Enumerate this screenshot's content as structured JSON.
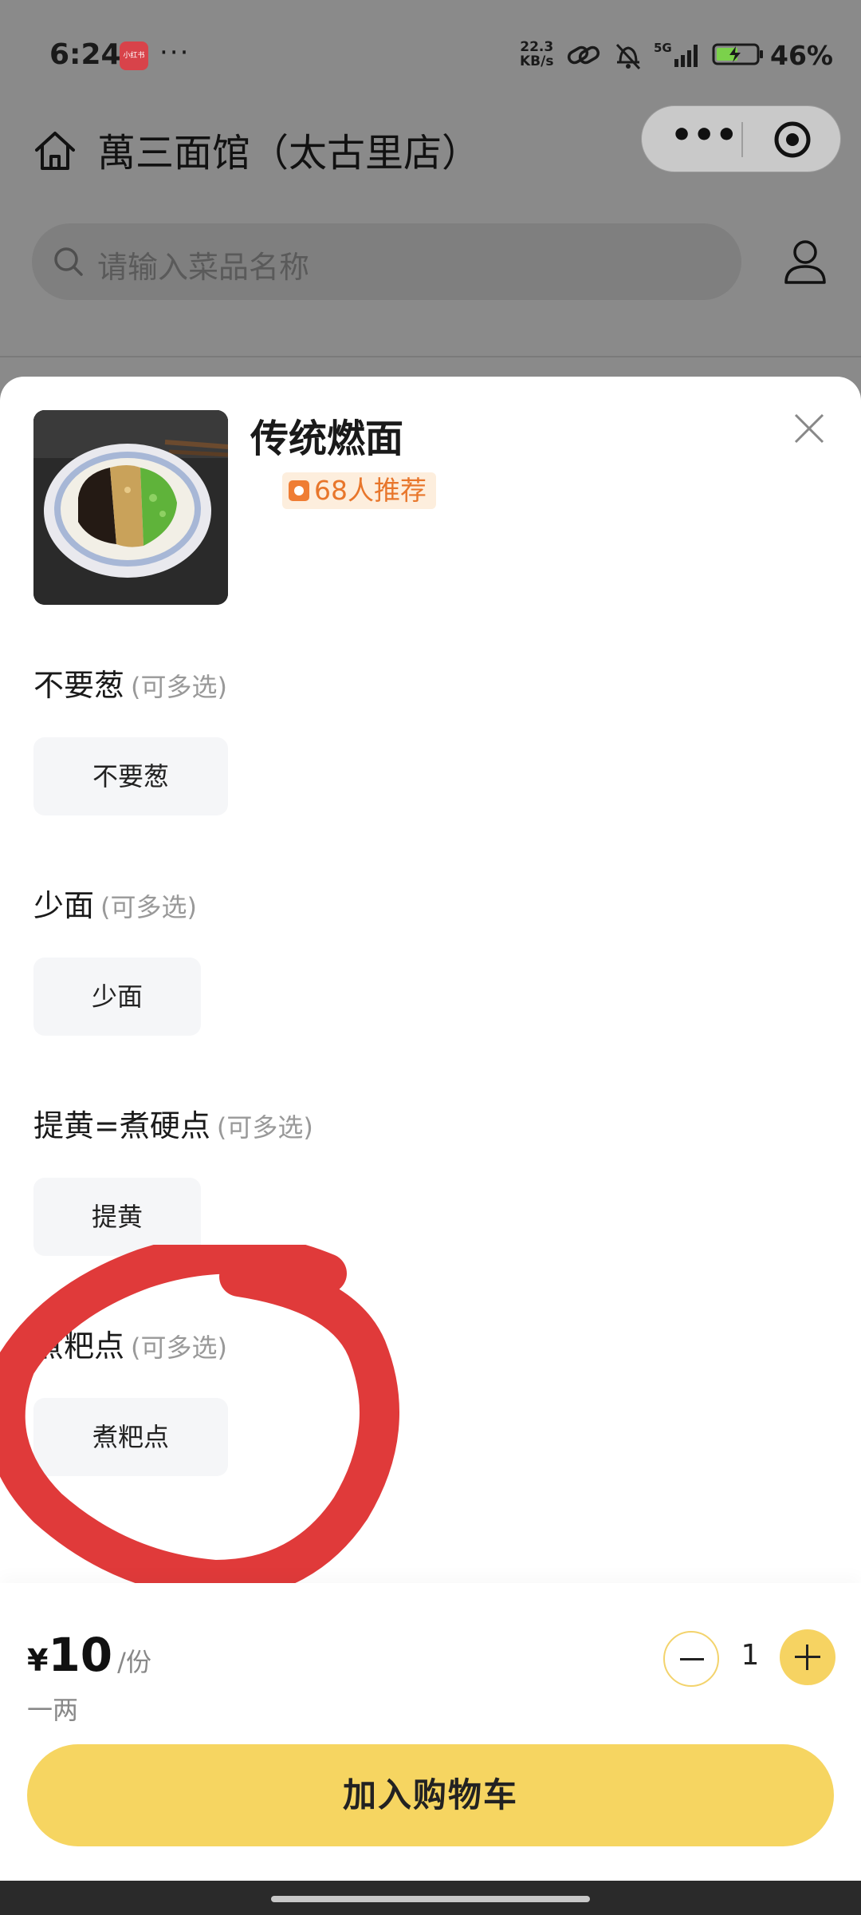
{
  "status_bar": {
    "time": "6:24",
    "app_badge": "小红书",
    "more": "···",
    "net_speed_value": "22.3",
    "net_speed_unit": "KB/s",
    "signal_label": "5G",
    "battery": "46%"
  },
  "nav": {
    "store_title": "萬三面馆（太古里店）",
    "capsule_more": "•••"
  },
  "search": {
    "placeholder": "请输入菜品名称"
  },
  "dish": {
    "name": "传统燃面",
    "recommend": "68人推荐"
  },
  "options": [
    {
      "title": "不要葱",
      "hint": "(可多选)",
      "choice": "不要葱"
    },
    {
      "title": "少面",
      "hint": "(可多选)",
      "choice": "少面"
    },
    {
      "title": "提黄=煮硬点",
      "hint": "(可多选)",
      "choice": "提黄"
    },
    {
      "title": "煮粑点",
      "hint": "(可多选)",
      "choice": "煮粑点"
    }
  ],
  "bottom": {
    "currency": "¥",
    "price": "10",
    "unit": "/份",
    "spec": "一两",
    "quantity": "1",
    "add_to_cart": "加入购物车"
  },
  "colors": {
    "accent": "#f6d561",
    "badge_text": "#e8762b",
    "annotation": "#e03a3a"
  }
}
